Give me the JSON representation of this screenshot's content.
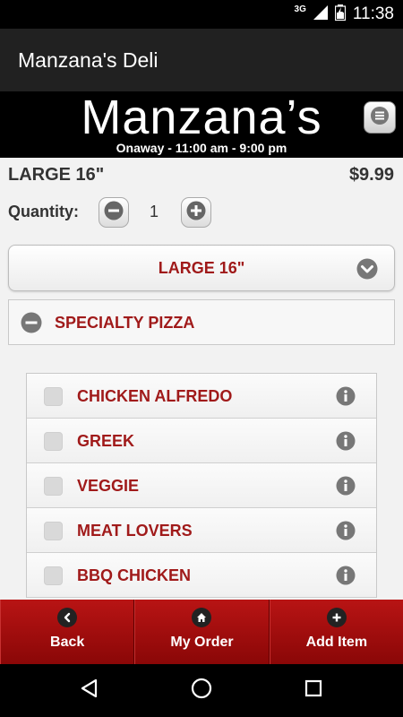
{
  "status_bar": {
    "network_type": "3G",
    "time": "11:38",
    "icons": [
      "signal-icon",
      "battery-icon"
    ]
  },
  "app_bar": {
    "title": "Manzana's Deli"
  },
  "brand": {
    "logo_text": "Manzana’s",
    "hours": "Onaway - 11:00 am - 9:00 pm",
    "menu_icon": "menu-icon"
  },
  "item": {
    "title": "LARGE 16\"",
    "price": "$9.99",
    "quantity_label": "Quantity:",
    "quantity": "1"
  },
  "size_select": {
    "selected": "LARGE 16\""
  },
  "category": {
    "label": "SPECIALTY PIZZA"
  },
  "pizzas": [
    {
      "label": "CHICKEN ALFREDO"
    },
    {
      "label": "GREEK"
    },
    {
      "label": "VEGGIE"
    },
    {
      "label": "MEAT LOVERS"
    },
    {
      "label": "BBQ CHICKEN"
    }
  ],
  "actions": {
    "back": "Back",
    "my_order": "My Order",
    "add_item": "Add Item"
  },
  "colors": {
    "accent_red": "#a01a1a",
    "action_bar_red": "#9b0f0f",
    "app_bar": "#212121"
  }
}
